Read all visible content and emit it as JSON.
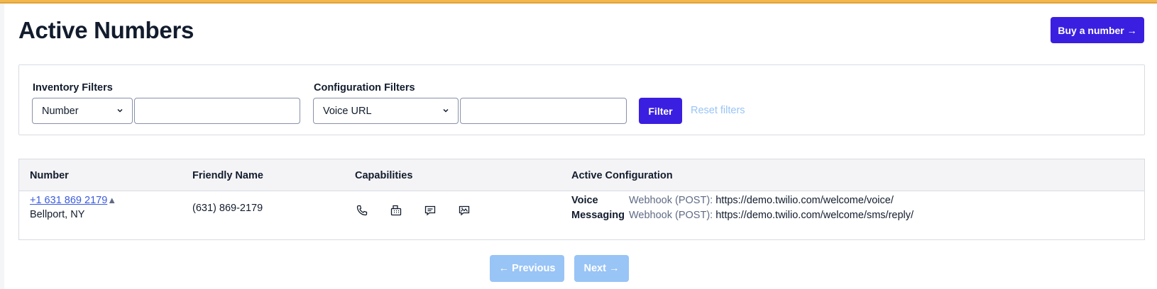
{
  "page": {
    "title": "Active Numbers",
    "buy_button": "Buy a number →"
  },
  "filters": {
    "inventory_label": "Inventory Filters",
    "inventory_select": "Number",
    "inventory_value": "",
    "configuration_label": "Configuration Filters",
    "configuration_select": "Voice URL",
    "configuration_value": "",
    "filter_button": "Filter",
    "reset_link": "Reset filters"
  },
  "table": {
    "columns": [
      "Number",
      "Friendly Name",
      "Capabilities",
      "Active Configuration"
    ],
    "rows": [
      {
        "number": "+1 631 869 2179",
        "sort_glyph": "▲",
        "location": "Bellport, NY",
        "friendly_name": "(631) 869-2179",
        "capabilities": [
          "phone-icon",
          "fax-icon",
          "sms-icon",
          "mms-icon"
        ],
        "config": [
          {
            "key": "Voice",
            "method": "Webhook (POST):",
            "url": "https://demo.twilio.com/welcome/voice/"
          },
          {
            "key": "Messaging",
            "method": "Webhook (POST):",
            "url": "https://demo.twilio.com/welcome/sms/reply/"
          }
        ]
      }
    ]
  },
  "pagination": {
    "previous": "← Previous",
    "next": "Next →"
  },
  "colors": {
    "primary": "#3a1fe0",
    "disabled": "#99c4f6",
    "link": "#3a5bde",
    "top_bar": "#f2b84b"
  }
}
